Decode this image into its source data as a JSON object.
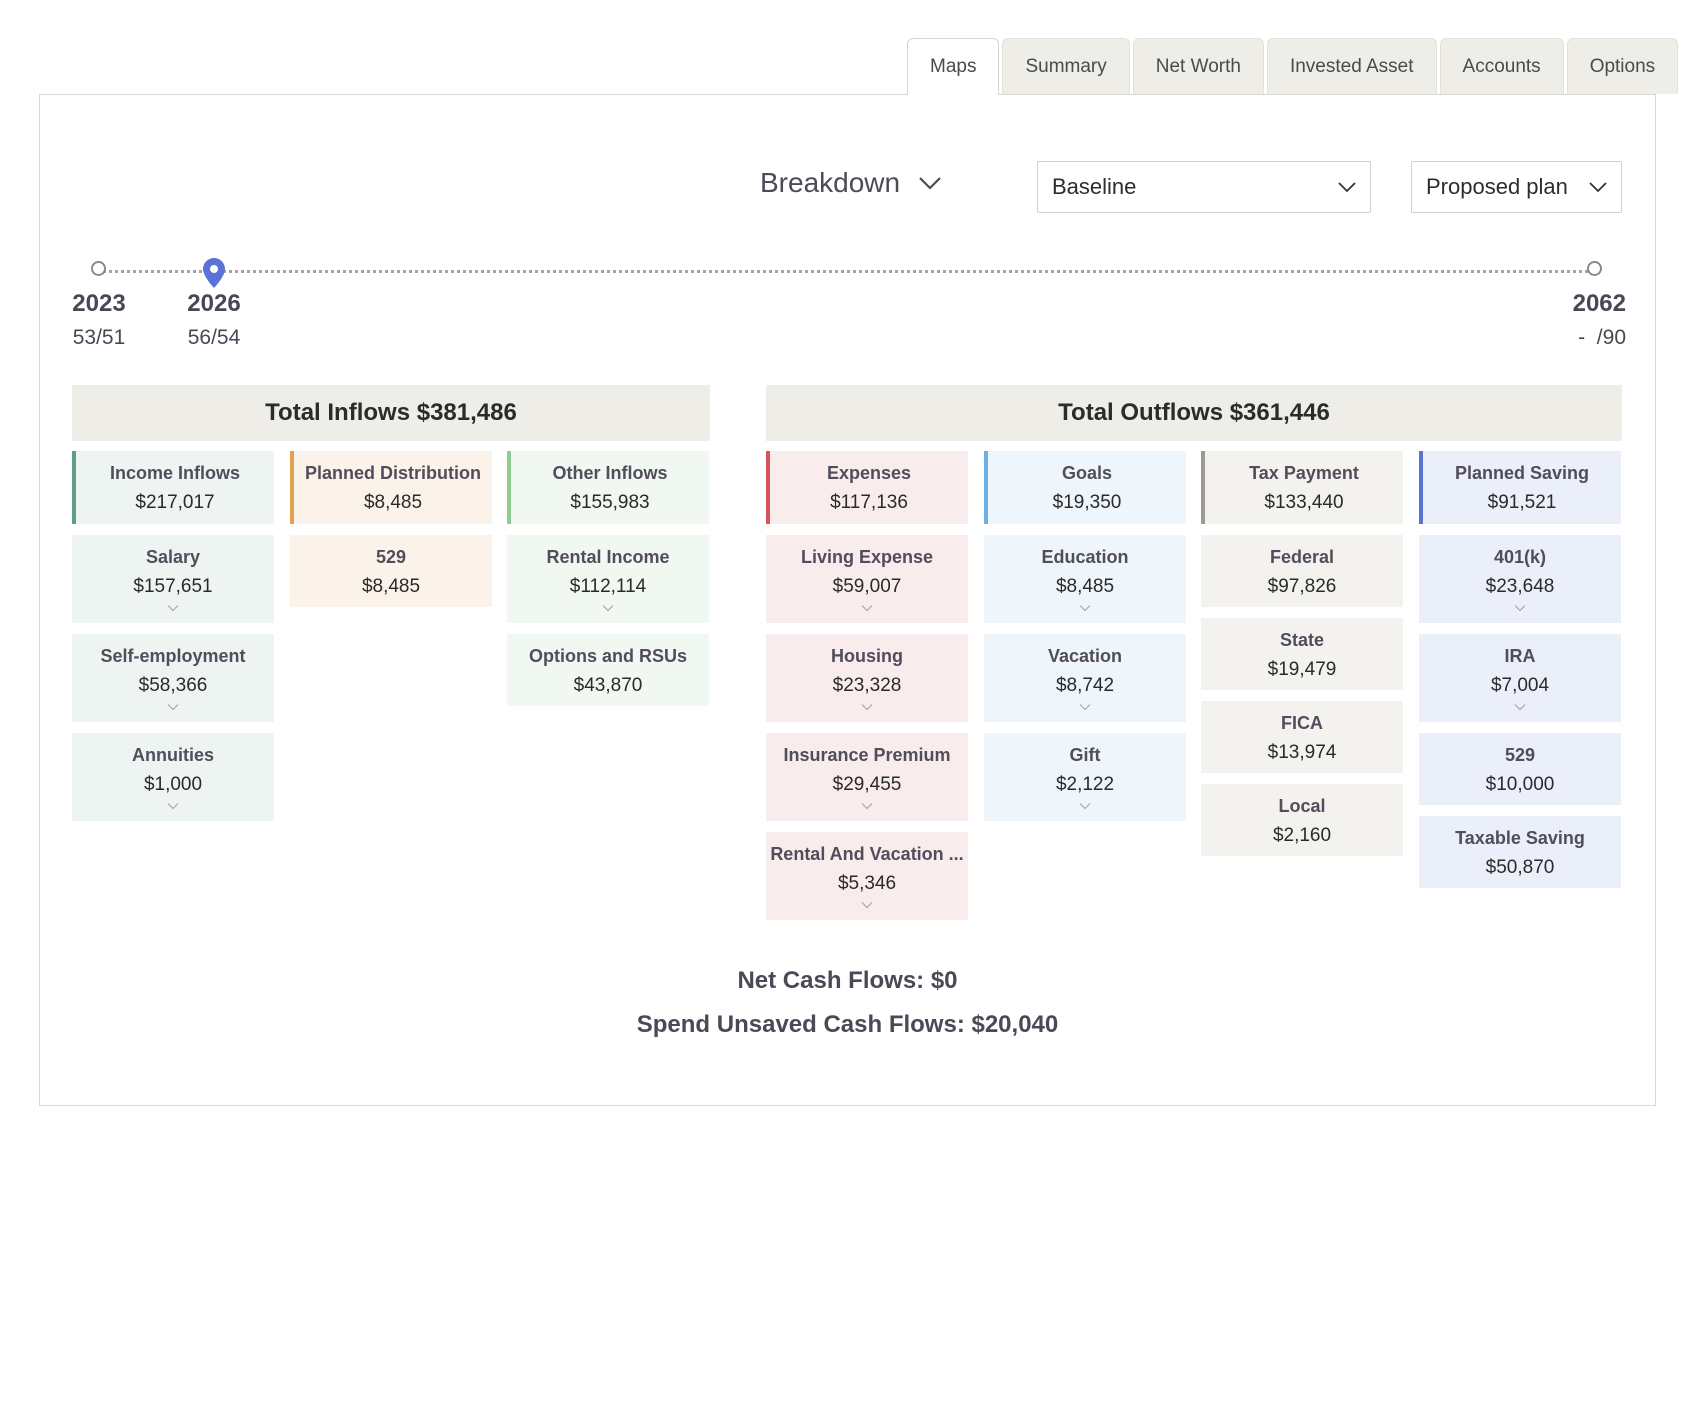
{
  "tabs": [
    {
      "label": "Maps",
      "active": true
    },
    {
      "label": "Summary",
      "active": false
    },
    {
      "label": "Net Worth",
      "active": false
    },
    {
      "label": "Invested Asset",
      "active": false
    },
    {
      "label": "Accounts",
      "active": false
    },
    {
      "label": "Options",
      "active": false
    }
  ],
  "controls": {
    "breakdown_label": "Breakdown",
    "baseline_select": "Baseline",
    "proposed_select": "Proposed plan"
  },
  "timeline": {
    "start": {
      "year": "2023",
      "ages": "53/51"
    },
    "selected": {
      "year": "2026",
      "ages": "56/54"
    },
    "end": {
      "year": "2062",
      "ages": "-  /90"
    },
    "accent_color": "#5a73d6"
  },
  "inflows": {
    "title": "Total Inflows $381,486",
    "columns": [
      {
        "head": {
          "label": "Income Inflows",
          "value": "$217,017"
        },
        "items": [
          {
            "label": "Salary",
            "value": "$157,651",
            "expandable": true
          },
          {
            "label": "Self-employment",
            "value": "$58,366",
            "expandable": true
          },
          {
            "label": "Annuities",
            "value": "$1,000",
            "expandable": true
          }
        ]
      },
      {
        "head": {
          "label": "Planned Distribution",
          "value": "$8,485"
        },
        "items": [
          {
            "label": "529",
            "value": "$8,485",
            "expandable": false
          }
        ]
      },
      {
        "head": {
          "label": "Other Inflows",
          "value": "$155,983"
        },
        "items": [
          {
            "label": "Rental Income",
            "value": "$112,114",
            "expandable": true
          },
          {
            "label": "Options and RSUs",
            "value": "$43,870",
            "expandable": false
          }
        ]
      }
    ]
  },
  "outflows": {
    "title": "Total Outflows $361,446",
    "columns": [
      {
        "head": {
          "label": "Expenses",
          "value": "$117,136"
        },
        "items": [
          {
            "label": "Living Expense",
            "value": "$59,007",
            "expandable": true
          },
          {
            "label": "Housing",
            "value": "$23,328",
            "expandable": true
          },
          {
            "label": "Insurance Premium",
            "value": "$29,455",
            "expandable": true
          },
          {
            "label": "Rental And Vacation ...",
            "value": "$5,346",
            "expandable": true
          }
        ]
      },
      {
        "head": {
          "label": "Goals",
          "value": "$19,350"
        },
        "items": [
          {
            "label": "Education",
            "value": "$8,485",
            "expandable": true
          },
          {
            "label": "Vacation",
            "value": "$8,742",
            "expandable": true
          },
          {
            "label": "Gift",
            "value": "$2,122",
            "expandable": true
          }
        ]
      },
      {
        "head": {
          "label": "Tax Payment",
          "value": "$133,440"
        },
        "items": [
          {
            "label": "Federal",
            "value": "$97,826",
            "expandable": false
          },
          {
            "label": "State",
            "value": "$19,479",
            "expandable": false
          },
          {
            "label": "FICA",
            "value": "$13,974",
            "expandable": false
          },
          {
            "label": "Local",
            "value": "$2,160",
            "expandable": false
          }
        ]
      },
      {
        "head": {
          "label": "Planned Saving",
          "value": "$91,521"
        },
        "items": [
          {
            "label": "401(k)",
            "value": "$23,648",
            "expandable": true
          },
          {
            "label": "IRA",
            "value": "$7,004",
            "expandable": true
          },
          {
            "label": "529",
            "value": "$10,000",
            "expandable": false
          },
          {
            "label": "Taxable Saving",
            "value": "$50,870",
            "expandable": false
          }
        ]
      }
    ]
  },
  "summary": {
    "net_cash_flows": "Net Cash Flows: $0",
    "spend_unsaved": "Spend Unsaved Cash Flows: $20,040"
  }
}
